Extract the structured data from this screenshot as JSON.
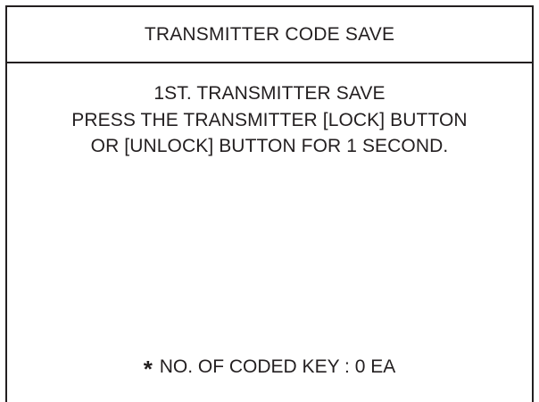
{
  "screen": {
    "title": "TRANSMITTER CODE SAVE",
    "message_lines": [
      "1ST. TRANSMITTER SAVE",
      "PRESS THE TRANSMITTER [LOCK] BUTTON",
      "OR [UNLOCK] BUTTON FOR 1 SECOND."
    ],
    "footer_symbol": "*",
    "footer_text": "NO. OF CODED KEY : 0 EA"
  }
}
